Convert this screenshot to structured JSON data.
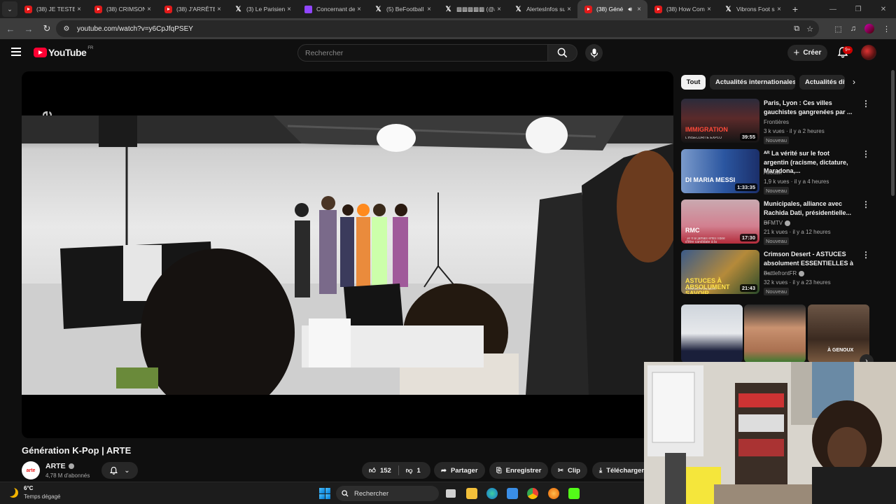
{
  "browser": {
    "tabs": [
      {
        "title": "(38) JE TESTE L",
        "type": "yt"
      },
      {
        "title": "(38) CRIMSON",
        "type": "yt"
      },
      {
        "title": "(38) J'ARRÊTE T",
        "type": "yt"
      },
      {
        "title": "(3) Le Parisien",
        "type": "x"
      },
      {
        "title": "Concernant de",
        "type": "tw"
      },
      {
        "title": "(5) BeFootball",
        "type": "x"
      },
      {
        "title": "▩▩▩▩▩ (@a",
        "type": "x"
      },
      {
        "title": "AlertesInfos su",
        "type": "x"
      },
      {
        "title": "(38) Géné",
        "type": "yt",
        "active": true
      },
      {
        "title": "(38) How Com",
        "type": "yt"
      },
      {
        "title": "Vibrons Foot s",
        "type": "x"
      }
    ],
    "url": "youtube.com/watch?v=y6CpJfqPSEY"
  },
  "youtube": {
    "logo_text": "YouTube",
    "region": "FR",
    "search_placeholder": "Rechercher",
    "create_label": "Créer",
    "notification_count": "9+"
  },
  "video": {
    "title": "Génération K-Pop | ARTE",
    "channel": "ARTE",
    "channel_avatar_text": "arte",
    "subscribers": "4,78 M d'abonnés",
    "likes": "152",
    "dislikes": "1",
    "share_label": "Partager",
    "save_label": "Enregistrer",
    "clip_label": "Clip",
    "download_label": "Télécharger"
  },
  "chips": [
    "Tout",
    "Actualités internationales",
    "Actualités div"
  ],
  "recommendations": [
    {
      "title": "Paris, Lyon : Ces villes gauchistes gangrenées par ...",
      "channel": "Frontières",
      "meta": "3 k vues · il y a 2 heures",
      "badge": "Nouveau",
      "duration": "39:55",
      "thumb_text": "IMMIGRATION",
      "thumb_sub": "L'INSÉCURITÉ EXPLO",
      "verified": false
    },
    {
      "title": "ᴬᴿ La vérité sur le foot argentin (racisme, dictature, Maradona,...",
      "channel": "Aliotalk",
      "meta": "1,9 k vues · il y a 4 heures",
      "badge": "Nouveau",
      "duration": "1:33:35",
      "thumb_text": "DI MARIA MESSI",
      "thumb_sub": "",
      "verified": false
    },
    {
      "title": "Municipales, alliance avec Rachida Dati, présidentielle... ...",
      "channel": "BFMTV",
      "meta": "21 k vues · il y a 12 heures",
      "badge": "Nouveau",
      "duration": "17:30",
      "thumb_text": "RMC",
      "thumb_sub": "\"Je n'ai jamais émis l'idée d'être candidate à la présidentielle\"",
      "verified": true
    },
    {
      "title": "Crimson Desert - ASTUCES absolument ESSENTIELLES à ...",
      "channel": "BattlefrontFR",
      "meta": "32 k vues · il y a 23 heures",
      "badge": "Nouveau",
      "duration": "21:43",
      "thumb_text": "ASTUCES À ABSOLUMENT SAVOIR",
      "thumb_sub": "CRIMSON DESERT",
      "verified": true
    }
  ],
  "shorts": [
    {
      "text": ""
    },
    {
      "text": ""
    },
    {
      "text": "À GENOUX"
    }
  ],
  "taskbar": {
    "temperature": "6°C",
    "weather": "Temps dégagé",
    "search_label": "Rechercher"
  },
  "colors": {
    "yt_red": "#ff0033",
    "bg": "#0f0f0f",
    "chip": "#272727"
  }
}
